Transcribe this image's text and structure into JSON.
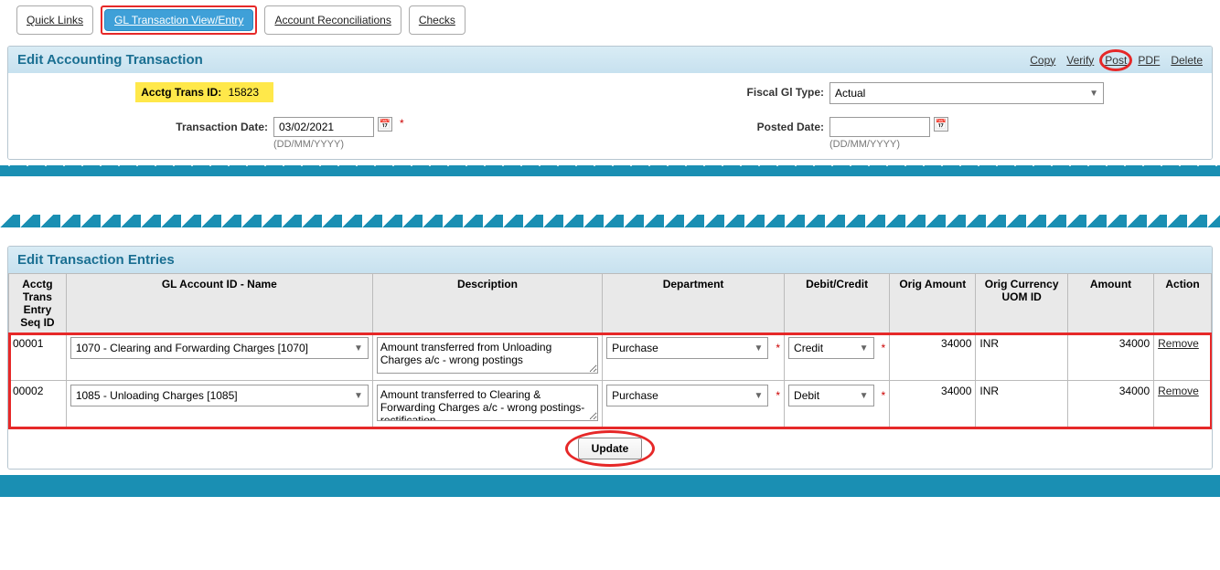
{
  "tabs": {
    "quick_links": "Quick Links",
    "gl_view": "GL Transaction View/Entry",
    "reconcile": "Account Reconciliations",
    "checks": "Checks"
  },
  "panel1": {
    "title": "Edit Accounting Transaction",
    "actions": {
      "copy": "Copy",
      "verify": "Verify",
      "post": "Post",
      "pdf": "PDF",
      "delete": "Delete"
    },
    "form": {
      "acctg_trans_id_label": "Acctg Trans ID:",
      "acctg_trans_id": "15823",
      "fiscal_gl_type_label": "Fiscal Gl Type:",
      "fiscal_gl_type": "Actual",
      "transaction_date_label": "Transaction Date:",
      "transaction_date": "03/02/2021",
      "date_format_hint": "(DD/MM/YYYY)",
      "posted_date_label": "Posted Date:",
      "posted_date": ""
    }
  },
  "panel2": {
    "title": "Edit Transaction Entries",
    "columns": {
      "seq": "Acctg Trans Entry Seq ID",
      "gl": "GL Account ID - Name",
      "desc": "Description",
      "dept": "Department",
      "dc": "Debit/Credit",
      "orig_amount": "Orig Amount",
      "orig_currency": "Orig Currency UOM ID",
      "amount": "Amount",
      "action": "Action"
    },
    "rows": [
      {
        "seq": "00001",
        "gl": "1070 - Clearing and Forwarding Charges [1070]",
        "desc": "Amount transferred from Unloading Charges a/c - wrong postings",
        "dept": "Purchase",
        "dc": "Credit",
        "orig_amount": "34000",
        "orig_currency": "INR",
        "amount": "34000"
      },
      {
        "seq": "00002",
        "gl": "1085 - Unloading Charges [1085]",
        "desc": "Amount transferred to Clearing & Forwarding Charges a/c - wrong postings-rectification",
        "dept": "Purchase",
        "dc": "Debit",
        "orig_amount": "34000",
        "orig_currency": "INR",
        "amount": "34000"
      }
    ],
    "remove_label": "Remove",
    "update_label": "Update"
  }
}
